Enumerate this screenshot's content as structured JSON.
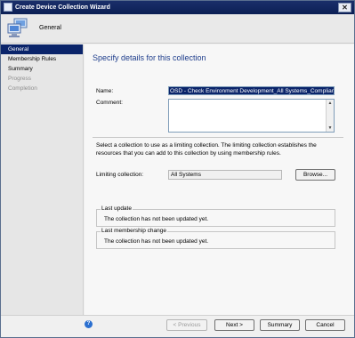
{
  "window": {
    "title": "Create Device Collection Wizard",
    "close_glyph": "✕"
  },
  "header": {
    "title": "General",
    "icon": "computers-icon"
  },
  "sidebar": {
    "items": [
      {
        "label": "General",
        "state": "active"
      },
      {
        "label": "Membership Rules",
        "state": "enabled"
      },
      {
        "label": "Summary",
        "state": "enabled"
      },
      {
        "label": "Progress",
        "state": "disabled"
      },
      {
        "label": "Completion",
        "state": "disabled"
      }
    ]
  },
  "main": {
    "page_title": "Specify details for this collection",
    "name_label": "Name:",
    "name_value": "OSD - Check Environment Development_All Systems_Compliant",
    "comment_label": "Comment:",
    "comment_value": "",
    "description": "Select a collection to use as a limiting collection. The limiting collection establishes the resources that you can add to this collection by using membership rules.",
    "limiting_label": "Limiting collection:",
    "limiting_value": "All Systems",
    "browse_label": "Browse...",
    "last_update": {
      "title": "Last update",
      "text": "The collection has not been updated yet."
    },
    "last_membership": {
      "title": "Last membership change",
      "text": "The collection has not been updated yet."
    }
  },
  "footer": {
    "help_glyph": "?",
    "previous_label": "< Previous",
    "next_label": "Next >",
    "summary_label": "Summary",
    "cancel_label": "Cancel"
  },
  "colors": {
    "title_bar": "#0c1f55",
    "selection": "#0a246a",
    "page_title": "#1f3e8c"
  }
}
